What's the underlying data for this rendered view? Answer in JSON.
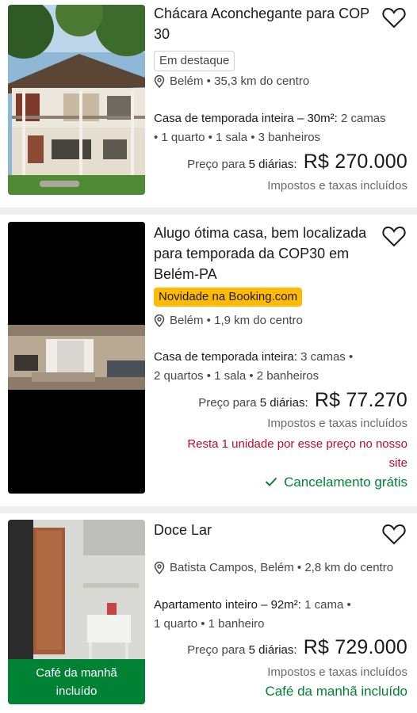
{
  "listings": [
    {
      "title": "Chácara Aconchegante para COP 30",
      "badge": "Em destaque",
      "location": "Belém • 35,3 km do centro",
      "unit_type": "Casa de temporada inteira – 30m²:",
      "unit_details_1": " 2 camas",
      "unit_details_2": "• 1 quarto • 1 sala • 3 banheiros",
      "price_label": "Preço para",
      "price_days": "5 diárias:",
      "price": "R$ 270.000",
      "taxes": "Impostos e taxas incluídos"
    },
    {
      "title": "Alugo ótima casa, bem localizada para temporada da COP30 em Belém-PA",
      "badge": "Novidade na Booking.com",
      "location": "Belém • 1,9 km do centro",
      "unit_type": "Casa de temporada inteira:",
      "unit_details_1": " 3 camas •",
      "unit_details_2": "2 quartos • 1 sala • 2 banheiros",
      "price_label": "Preço para",
      "price_days": "5 diárias:",
      "price": "R$ 77.270",
      "taxes": "Impostos e taxas incluídos",
      "warning": "Resta 1 unidade por esse preço no nosso site",
      "cancellation": "Cancelamento grátis"
    },
    {
      "title": "Doce Lar",
      "location": "Batista Campos, Belém • 2,8 km do centro",
      "unit_type": "Apartamento inteiro – 92m²:",
      "unit_details_1": " 1 cama •",
      "unit_details_2": "1 quarto • 1 banheiro",
      "price_label": "Preço para",
      "price_days": "5 diárias:",
      "price": "R$ 729.000",
      "taxes": "Impostos e taxas incluídos",
      "photo_badge": "Café da manhã incluído",
      "breakfast": "Café da manhã incluído"
    }
  ],
  "colors": {
    "brand_yellow": "#febb02",
    "green": "#008234",
    "warning_red": "#c00a27",
    "text": "#1a1a1a",
    "muted": "#474747"
  },
  "icons": {
    "favorite": "heart-outline-icon",
    "location": "map-pin-icon",
    "check": "checkmark-icon"
  }
}
